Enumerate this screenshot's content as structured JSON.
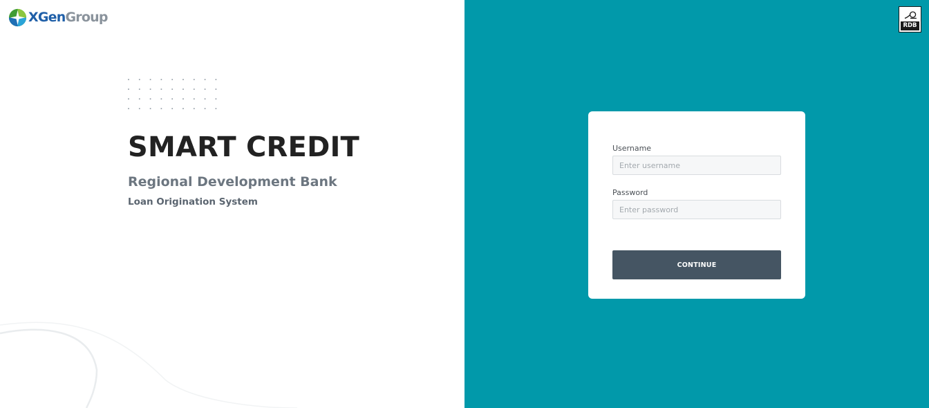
{
  "brand": {
    "logo_x": "X",
    "logo_gen": "Gen",
    "logo_group": "Group",
    "colors": {
      "accent_teal": "#0199aa",
      "button_slate": "#455563",
      "logo_blue": "#1f5fa8",
      "logo_grey": "#8a939c"
    }
  },
  "hero": {
    "title": "SMART CREDIT",
    "subtitle": "Regional Development Bank",
    "tagline": "Loan Origination System"
  },
  "badge": {
    "text": "RDB"
  },
  "login": {
    "username_label": "Username",
    "username_placeholder": "Enter username",
    "username_value": "",
    "password_label": "Password",
    "password_placeholder": "Enter password",
    "password_value": "",
    "continue_label": "CONTINUE"
  }
}
